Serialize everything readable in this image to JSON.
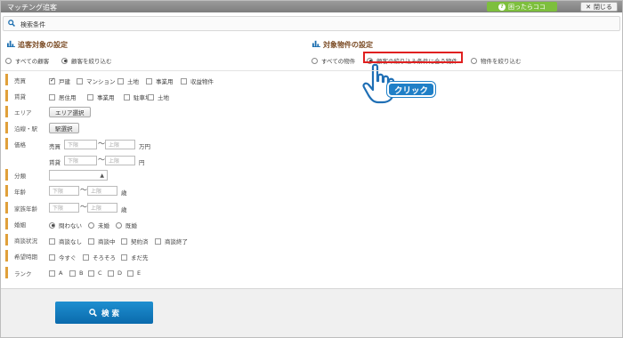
{
  "window": {
    "title": "マッチング追客"
  },
  "header": {
    "help_label": "困ったらココ",
    "close_label": "閉じる"
  },
  "search_panel": {
    "title": "検索条件"
  },
  "customer_section": {
    "title": "追客対象の設定",
    "options": [
      {
        "label": "すべての顧客",
        "selected": false
      },
      {
        "label": "顧客を絞り込む",
        "selected": true
      }
    ]
  },
  "property_section": {
    "title": "対象物件の設定",
    "options": [
      {
        "label": "すべての物件",
        "selected": false
      },
      {
        "label": "顧客の絞り込み条件に合う物件",
        "selected": true
      },
      {
        "label": "物件を絞り込む",
        "selected": false
      }
    ]
  },
  "annotation": {
    "click_label": "クリック"
  },
  "rows": {
    "sale": {
      "label": "売買",
      "items": [
        {
          "label": "戸建",
          "checked": true
        },
        {
          "label": "マンション",
          "checked": false
        },
        {
          "label": "土地",
          "checked": false
        },
        {
          "label": "事業用",
          "checked": false
        },
        {
          "label": "収益物件",
          "checked": false
        }
      ]
    },
    "rent": {
      "label": "賃貸",
      "items": [
        {
          "label": "居住用",
          "checked": false
        },
        {
          "label": "事業用",
          "checked": false
        },
        {
          "label": "駐車場",
          "checked": false
        },
        {
          "label": "土地",
          "checked": false
        }
      ]
    },
    "area": {
      "label": "エリア",
      "button": "エリア選択"
    },
    "station": {
      "label": "沿線・駅",
      "button": "駅選択"
    },
    "price": {
      "label": "価格",
      "sale_label": "売買",
      "rent_label": "賃貸",
      "min_placeholder": "下限",
      "max_placeholder": "上限",
      "sale_unit": "万円",
      "rent_unit": "円",
      "tilde": "～"
    },
    "category": {
      "label": "分類",
      "value": ""
    },
    "age": {
      "label": "年齢",
      "min_placeholder": "下限",
      "max_placeholder": "上限",
      "unit": "歳",
      "tilde": "～"
    },
    "family_age": {
      "label": "家族年齢",
      "min_placeholder": "下限",
      "max_placeholder": "上限",
      "unit": "歳",
      "tilde": "～"
    },
    "marriage": {
      "label": "婚姻",
      "options": [
        {
          "label": "問わない",
          "selected": true
        },
        {
          "label": "未婚",
          "selected": false
        },
        {
          "label": "既婚",
          "selected": false
        }
      ]
    },
    "deal": {
      "label": "商談状況",
      "items": [
        {
          "label": "商談なし"
        },
        {
          "label": "商談中"
        },
        {
          "label": "契約済"
        },
        {
          "label": "商談終了"
        }
      ]
    },
    "timing": {
      "label": "希望時期",
      "items": [
        {
          "label": "今すぐ"
        },
        {
          "label": "そろそろ"
        },
        {
          "label": "まだ先"
        }
      ]
    },
    "rank": {
      "label": "ランク",
      "items": [
        {
          "label": "A"
        },
        {
          "label": "B"
        },
        {
          "label": "C"
        },
        {
          "label": "D"
        },
        {
          "label": "E"
        }
      ]
    }
  },
  "footer": {
    "search_label": "検 索"
  }
}
